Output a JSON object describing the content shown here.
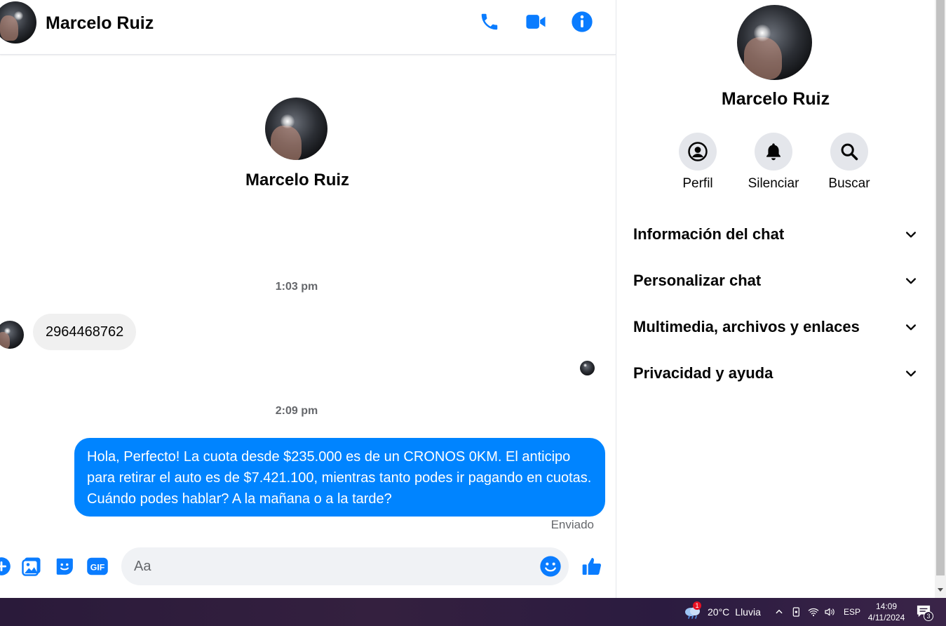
{
  "header": {
    "contact_name": "Marcelo Ruiz"
  },
  "intro": {
    "contact_name": "Marcelo Ruiz"
  },
  "messages": [
    {
      "timestamp": "1:03 pm",
      "direction": "incoming",
      "text": "2964468762"
    },
    {
      "timestamp": "2:09 pm",
      "direction": "outgoing",
      "text": "Hola, Perfecto! La cuota desde $235.000 es de un CRONOS 0KM. El anticipo para retirar el auto es de $7.421.100, mientras tanto podes ir pagando en cuotas. Cuándo podes hablar? A la mañana o a la tarde?",
      "status": "Enviado"
    }
  ],
  "composer": {
    "placeholder": "Aa"
  },
  "info_panel": {
    "contact_name": "Marcelo Ruiz",
    "actions": [
      {
        "label": "Perfil",
        "icon": "profile-icon"
      },
      {
        "label": "Silenciar",
        "icon": "bell-icon"
      },
      {
        "label": "Buscar",
        "icon": "search-icon"
      }
    ],
    "sections": [
      {
        "title": "Información del chat"
      },
      {
        "title": "Personalizar chat"
      },
      {
        "title": "Multimedia, archivos y enlaces"
      },
      {
        "title": "Privacidad y ayuda"
      }
    ]
  },
  "taskbar": {
    "weather_temp": "20°C",
    "weather_desc": "Lluvia",
    "weather_badge": "1",
    "language": "ESP",
    "time": "14:09",
    "date": "4/11/2024",
    "notification_count": "3"
  },
  "colors": {
    "accent": "#0084ff",
    "bubble_incoming": "#f0f0f0",
    "icon_blue": "#0a7cff"
  }
}
